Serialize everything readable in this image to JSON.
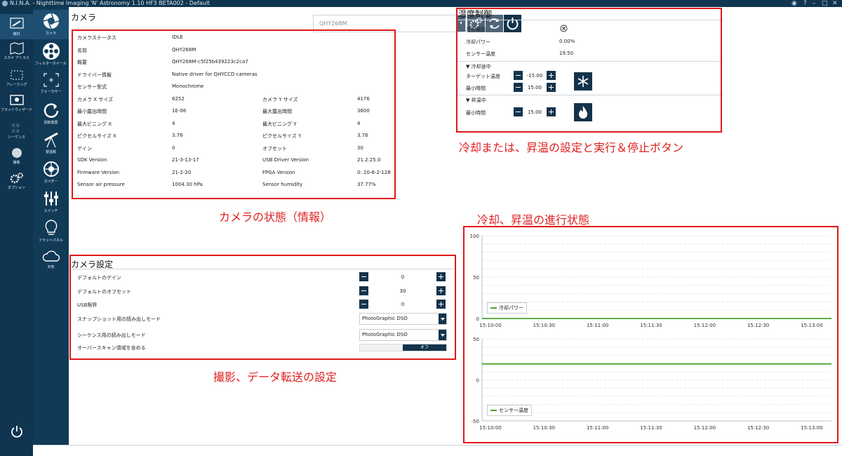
{
  "window": {
    "title": "N.I.N.A. - Nighttime Imaging 'N' Astronomy 1.10 HF3 BETA002  -  Default"
  },
  "rail_primary": [
    {
      "label": "機材",
      "icon": "telescope-icon",
      "active": true
    },
    {
      "label": "スカイ アトラス",
      "icon": "map-icon"
    },
    {
      "label": "フレーミング",
      "icon": "framing-icon"
    },
    {
      "label": "フラットウィザード",
      "icon": "flat-wizard-icon"
    },
    {
      "label": "シーケンス",
      "icon": "sequence-icon"
    },
    {
      "label": "撮像",
      "icon": "imaging-icon"
    },
    {
      "label": "オプション",
      "icon": "gear-icon"
    }
  ],
  "rail_secondary": [
    {
      "label": "カメラ",
      "icon": "camera-aperture-icon",
      "active": true
    },
    {
      "label": "フィルターホイール",
      "icon": "filter-wheel-icon"
    },
    {
      "label": "フォーカサー",
      "icon": "focuser-icon"
    },
    {
      "label": "回転装置",
      "icon": "rotator-icon"
    },
    {
      "label": "望遠鏡",
      "icon": "telescope-mount-icon"
    },
    {
      "label": "ガイダー",
      "icon": "guider-icon"
    },
    {
      "label": "スイッチ",
      "icon": "switch-icon"
    },
    {
      "label": "フラットパネル",
      "icon": "lightbulb-icon"
    },
    {
      "label": "天気",
      "icon": "cloud-icon"
    }
  ],
  "camera_panel": {
    "title": "カメラ",
    "device_selector": "QHY268M",
    "info_rows": [
      {
        "k1": "カメラステータス",
        "v1": "IDLE"
      },
      {
        "k1": "名前",
        "v1": "QHY268M"
      },
      {
        "k1": "概要",
        "v1": "QHY268M-c5f25b439223c2ca7"
      },
      {
        "k1": "ドライバー情報",
        "v1": "Native driver for QHYCCD cameras"
      },
      {
        "k1": "センサー型式",
        "v1": "Monochrome"
      },
      {
        "k1": "カメラ X サイズ",
        "v1": "6252",
        "k2": "カメラ Y サイズ",
        "v2": "4176"
      },
      {
        "k1": "最小露出時間",
        "v1": "1E-06",
        "k2": "最大露出時間",
        "v2": "3600"
      },
      {
        "k1": "最大ビニング X",
        "v1": "4",
        "k2": "最大ビニング Y",
        "v2": "4"
      },
      {
        "k1": "ピクセルサイズ X",
        "v1": "3.76",
        "k2": "ピクセルサイズ Y",
        "v2": "3.76"
      },
      {
        "k1": "ゲイン",
        "v1": "0",
        "k2": "オフセット",
        "v2": "30"
      },
      {
        "k1": "SDK Version",
        "v1": "21-3-13-17",
        "k2": "USB Driver Version",
        "v2": "21.2.25.0"
      },
      {
        "k1": "Firmware Version",
        "v1": "21-2-20",
        "k2": "FPGA Version",
        "v2": "0: 20-6-2-128"
      },
      {
        "k1": "Sensor air pressure",
        "v1": "1004.30 hPa",
        "k2": "Sensor humidity",
        "v2": "37.77%"
      }
    ]
  },
  "camera_settings": {
    "title": "カメラ設定",
    "rows": [
      {
        "label": "デフォルトのゲイン",
        "value": "0"
      },
      {
        "label": "デフォルトのオフセット",
        "value": "30"
      },
      {
        "label": "USB限界",
        "value": "0"
      }
    ],
    "snapshot_mode_label": "スナップショット用の読み出しモード",
    "snapshot_mode_value": "PhotoGraphic DSO",
    "sequence_mode_label": "シーケンス用の読み出しモード",
    "sequence_mode_value": "PhotoGraphic DSO",
    "overscan_label": "オーバースキャン領域を含める",
    "overscan_value": "オフ"
  },
  "temperature_control": {
    "title": "温度制御",
    "cooler_label": "冷却機能",
    "cooler_power_label": "冷却パワー",
    "cooler_power_value": "0.00%",
    "sensor_temp_label": "センサー温度",
    "sensor_temp_value": "19.50",
    "cooling_header": "▼ 冷却途中",
    "target_temp_label": "ターゲット温度",
    "target_temp_value": "-15.00",
    "min_time_label": "最小時間",
    "cool_min_time_value": "15.00",
    "warming_header": "▼ 昇温中",
    "warm_min_time_value": "15.00"
  },
  "annotations": {
    "temp": "冷却または、昇温の設定と実行＆停止ボタン",
    "camera_info": "カメラの状態（情報）",
    "progress": "冷却、昇温の進行状態",
    "settings": "撮影、データ転送の設定"
  },
  "colors": {
    "navy": "#13334b",
    "rail": "#0f3550",
    "annotation_red": "#e01818",
    "series_green": "#4aa32c"
  },
  "chart_data": [
    {
      "type": "line",
      "x": [
        "15:10:00",
        "15:10:30",
        "15:11:00",
        "15:11:30",
        "15:12:00",
        "15:12:30",
        "15:13:00"
      ],
      "yticks": [
        "100",
        "50",
        "0"
      ],
      "ylim": [
        0,
        100
      ],
      "series": [
        {
          "name": "冷却パワー",
          "values": [
            0,
            0,
            0,
            0,
            0,
            0,
            0
          ]
        }
      ],
      "grid": true,
      "legend_position": "bottom-left"
    },
    {
      "type": "line",
      "x": [
        "15:10:00",
        "15:10:30",
        "15:11:00",
        "15:11:30",
        "15:12:00",
        "15:12:30",
        "15:13:00"
      ],
      "yticks": [
        "50",
        "0",
        "-50"
      ],
      "ylim": [
        -50,
        50
      ],
      "series": [
        {
          "name": "センサー温度",
          "values": [
            19.5,
            19.5,
            19.5,
            19.5,
            19.5,
            19.5,
            19.5
          ]
        }
      ],
      "grid": true,
      "legend_position": "bottom-left"
    }
  ]
}
